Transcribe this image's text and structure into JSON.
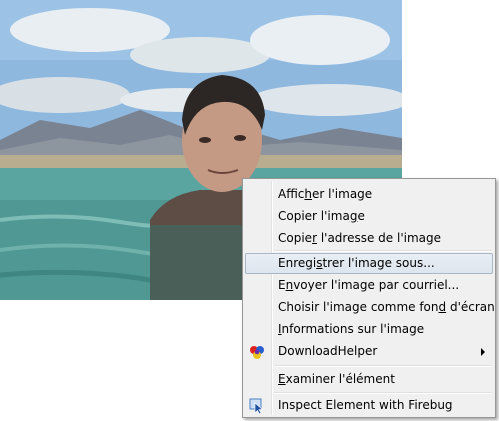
{
  "menu": {
    "items": [
      {
        "pre": "Affic",
        "key": "h",
        "post": "er l'image"
      },
      {
        "pre": "Copier l'ima",
        "key": "g",
        "post": "e"
      },
      {
        "pre": "Copie",
        "key": "r",
        "post": " l'adresse de l'image"
      },
      {
        "pre": "Enregi",
        "key": "s",
        "post": "trer l'image sous..."
      },
      {
        "pre": "E",
        "key": "n",
        "post": "voyer l'image par courriel..."
      },
      {
        "pre": "Choisir l'image comme fon",
        "key": "d",
        "post": " d'écran"
      },
      {
        "pre": "",
        "key": "I",
        "post": "nformations sur l'image"
      },
      {
        "pre": "DownloadHelper",
        "key": "",
        "post": ""
      },
      {
        "pre": "",
        "key": "E",
        "post": "xaminer l'élément"
      },
      {
        "pre": "Inspect Element with Firebug",
        "key": "",
        "post": ""
      }
    ],
    "hovered_item": "Enregistrer l'image sous...",
    "icons": {
      "downloadhelper": "downloadhelper-icon",
      "firebug": "firebug-inspect-icon"
    }
  },
  "colors": {
    "menu_background": "#f0f0f0",
    "hover_border": "#a9b6c5",
    "sky": "#9fc4e4",
    "sea": "#5aa5a0"
  }
}
